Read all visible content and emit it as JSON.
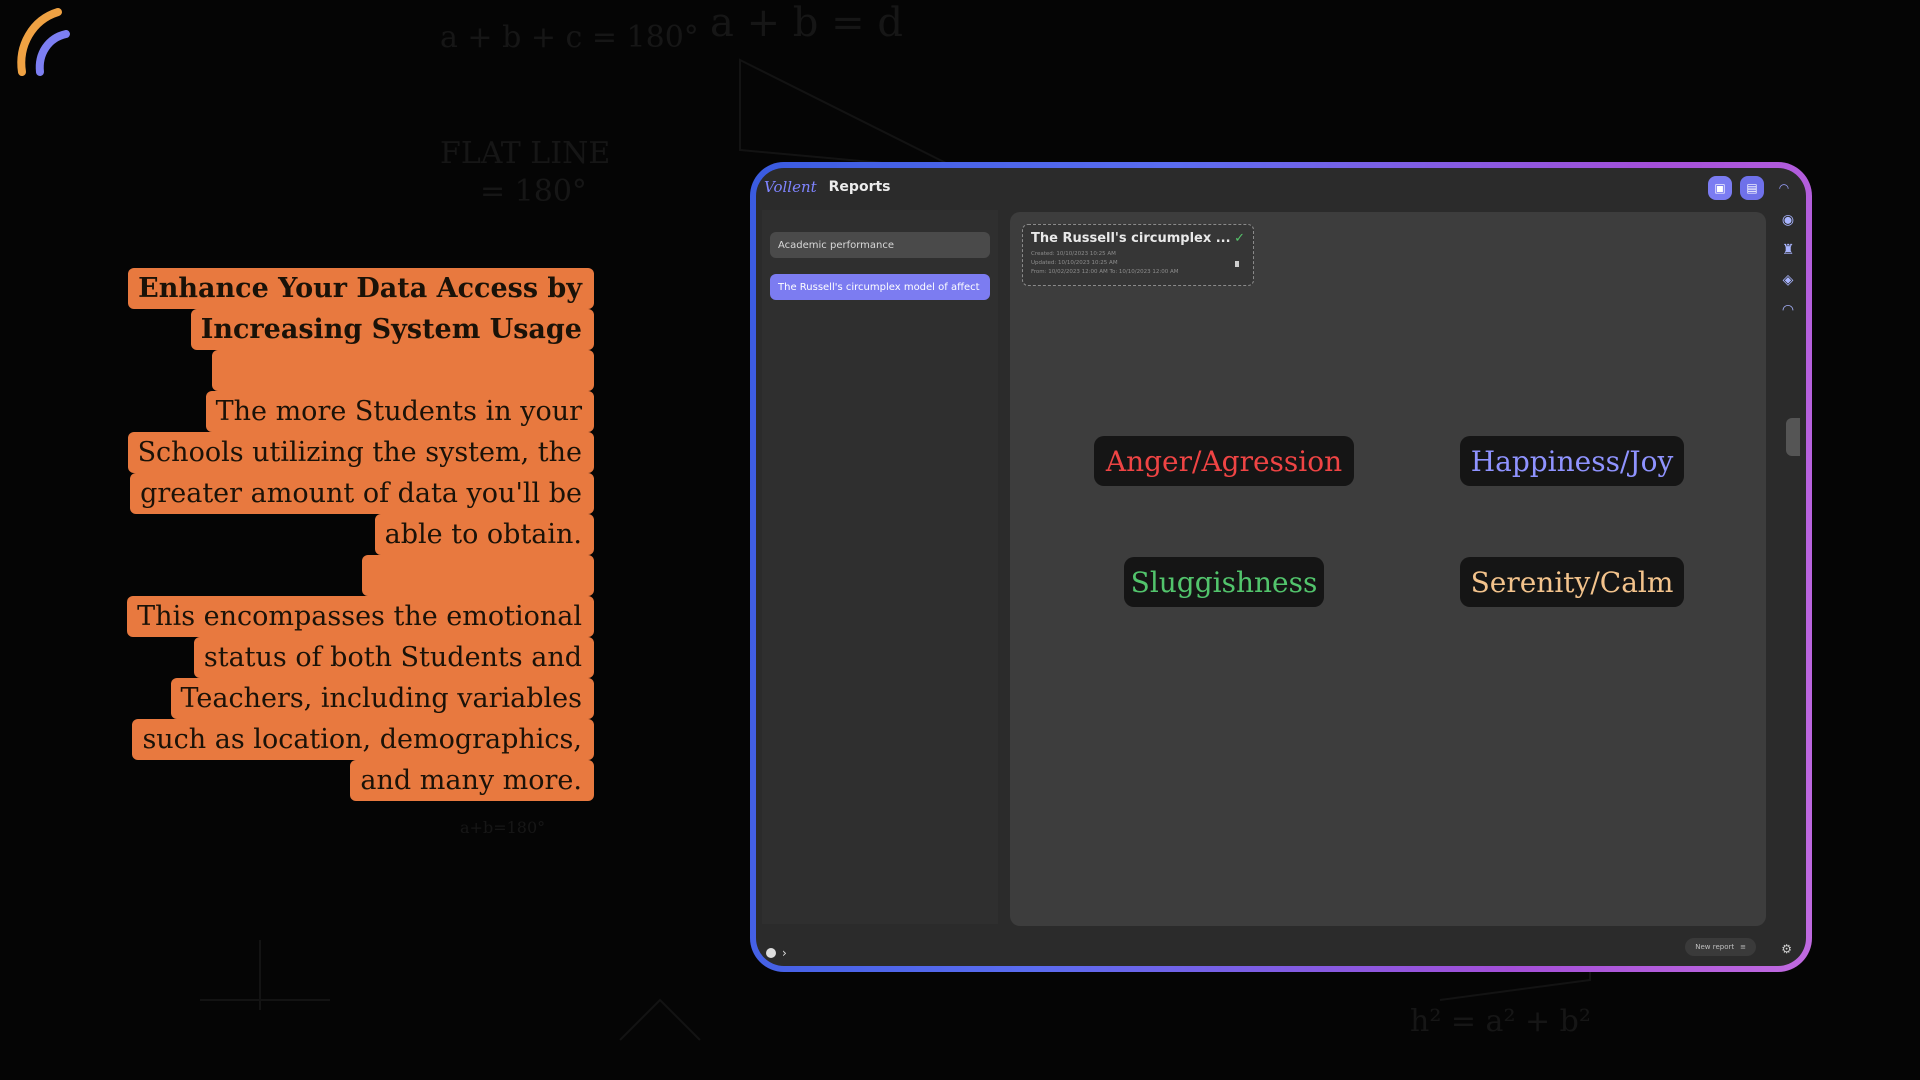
{
  "background": {
    "scribbles": [
      "a + b + c = 180°",
      "a + b = d",
      "FLAT LINE",
      "= 180°",
      "h² = a² + b²",
      "a+b=180°"
    ]
  },
  "promo": {
    "title_lines": [
      "Enhance Your Data Access by",
      "Increasing System Usage"
    ],
    "para1_lines": [
      "The more Students in your",
      "Schools utilizing the system, the",
      "greater amount of data you'll be",
      "able to obtain."
    ],
    "para2_lines": [
      "This encompasses the emotional",
      "status of both Students and",
      "Teachers, including variables",
      "such as location, demographics,",
      "and many more."
    ]
  },
  "app": {
    "brand": "Vollent",
    "title": "Reports",
    "sidebar": {
      "items": [
        {
          "label": "Academic performance"
        },
        {
          "label": "The Russell's circumplex model of affect"
        }
      ]
    },
    "report_card": {
      "title": "The Russell's circumplex ...",
      "created": "Created: 10/10/2023 10:25 AM",
      "updated": "Updated: 10/10/2023 10:25 AM",
      "range": "From: 10/02/2023 12:00 AM    To: 10/10/2023 12:00 AM"
    },
    "emotions": {
      "anger": "Anger/Agression",
      "happiness": "Happiness/Joy",
      "sluggishness": "Sluggishness",
      "serenity": "Serenity/Calm"
    },
    "bottom": {
      "new_report": "New report"
    }
  },
  "colors": {
    "promo_bg": "#e8793f",
    "accent": "#7c7cf1",
    "anger": "#ef4444",
    "happiness": "#8f93ff",
    "sluggishness": "#52c46c",
    "serenity": "#f3c38c"
  }
}
